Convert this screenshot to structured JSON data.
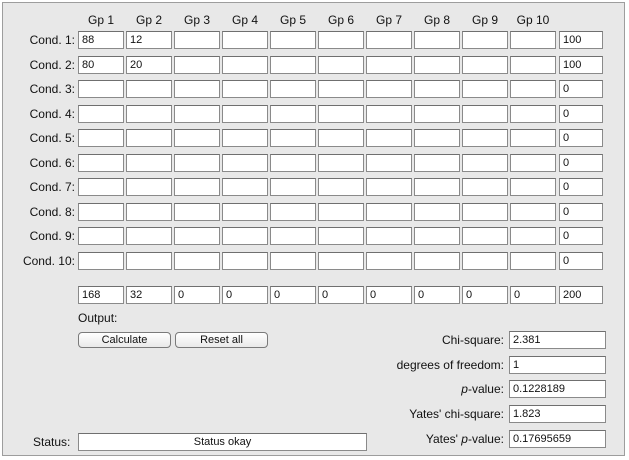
{
  "grid": {
    "col_headers": [
      "Gp 1",
      "Gp 2",
      "Gp 3",
      "Gp 4",
      "Gp 5",
      "Gp 6",
      "Gp 7",
      "Gp 8",
      "Gp 9",
      "Gp 10"
    ],
    "rows": [
      {
        "label": "Cond. 1:",
        "cells": [
          "88",
          "12",
          "",
          "",
          "",
          "",
          "",
          "",
          "",
          ""
        ],
        "total": "100"
      },
      {
        "label": "Cond. 2:",
        "cells": [
          "80",
          "20",
          "",
          "",
          "",
          "",
          "",
          "",
          "",
          ""
        ],
        "total": "100"
      },
      {
        "label": "Cond. 3:",
        "cells": [
          "",
          "",
          "",
          "",
          "",
          "",
          "",
          "",
          "",
          ""
        ],
        "total": "0"
      },
      {
        "label": "Cond. 4:",
        "cells": [
          "",
          "",
          "",
          "",
          "",
          "",
          "",
          "",
          "",
          ""
        ],
        "total": "0"
      },
      {
        "label": "Cond. 5:",
        "cells": [
          "",
          "",
          "",
          "",
          "",
          "",
          "",
          "",
          "",
          ""
        ],
        "total": "0"
      },
      {
        "label": "Cond. 6:",
        "cells": [
          "",
          "",
          "",
          "",
          "",
          "",
          "",
          "",
          "",
          ""
        ],
        "total": "0"
      },
      {
        "label": "Cond. 7:",
        "cells": [
          "",
          "",
          "",
          "",
          "",
          "",
          "",
          "",
          "",
          ""
        ],
        "total": "0"
      },
      {
        "label": "Cond. 8:",
        "cells": [
          "",
          "",
          "",
          "",
          "",
          "",
          "",
          "",
          "",
          ""
        ],
        "total": "0"
      },
      {
        "label": "Cond. 9:",
        "cells": [
          "",
          "",
          "",
          "",
          "",
          "",
          "",
          "",
          "",
          ""
        ],
        "total": "0"
      },
      {
        "label": "Cond. 10:",
        "cells": [
          "",
          "",
          "",
          "",
          "",
          "",
          "",
          "",
          "",
          ""
        ],
        "total": "0"
      }
    ],
    "column_totals": [
      "168",
      "32",
      "0",
      "0",
      "0",
      "0",
      "0",
      "0",
      "0",
      "0"
    ],
    "grand_total": "200"
  },
  "output_label": "Output:",
  "buttons": {
    "calculate": "Calculate",
    "reset": "Reset all"
  },
  "results": {
    "chi_square_label": "Chi-square:",
    "chi_square": "2.381",
    "df_label": "degrees of freedom:",
    "df": "1",
    "p_prefix": "p",
    "p_label_suffix": "-value:",
    "p_value": "0.1228189",
    "yates_chi_label": "Yates' chi-square:",
    "yates_chi": "1.823",
    "yates_p_prefix": "Yates' ",
    "yates_p_italic": "p",
    "yates_p_suffix": "-value:",
    "yates_p_value": "0.17695659"
  },
  "status": {
    "label": "Status:",
    "text": "Status okay"
  }
}
